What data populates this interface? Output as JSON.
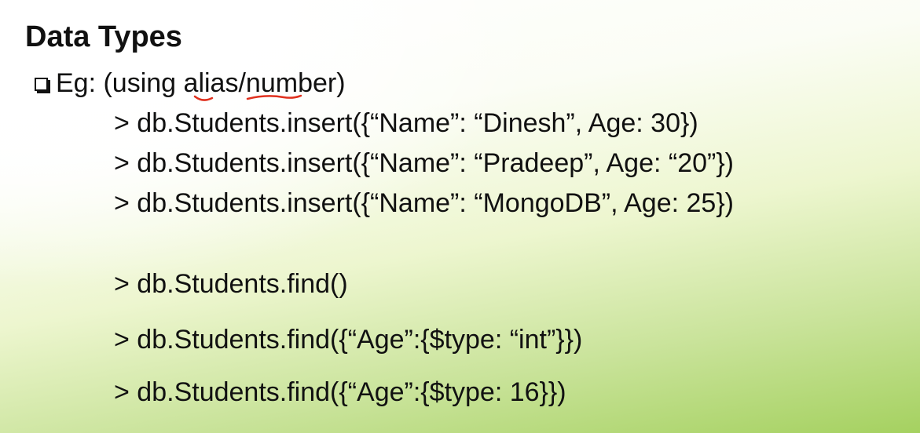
{
  "slide": {
    "title": "Data Types",
    "bullet": {
      "prefix": "Eg: (using ",
      "word1": "alias",
      "separator": "/",
      "word2": "number",
      "suffix": ")",
      "annotation_color": "#e0301e"
    },
    "lines": [
      "> db.Students.insert({“Name”: “Dinesh”, Age: 30})",
      "> db.Students.insert({“Name”: “Pradeep”, Age: “20”})",
      "> db.Students.insert({“Name”: “MongoDB”, Age: 25})",
      "> db.Students.find()",
      "> db.Students.find({“Age”:{$type: “int”}})",
      "> db.Students.find({“Age”:{$type: 16}})"
    ]
  },
  "colors": {
    "background_top": "#ffffff",
    "background_bottom": "#a5d160",
    "text": "#111111"
  }
}
